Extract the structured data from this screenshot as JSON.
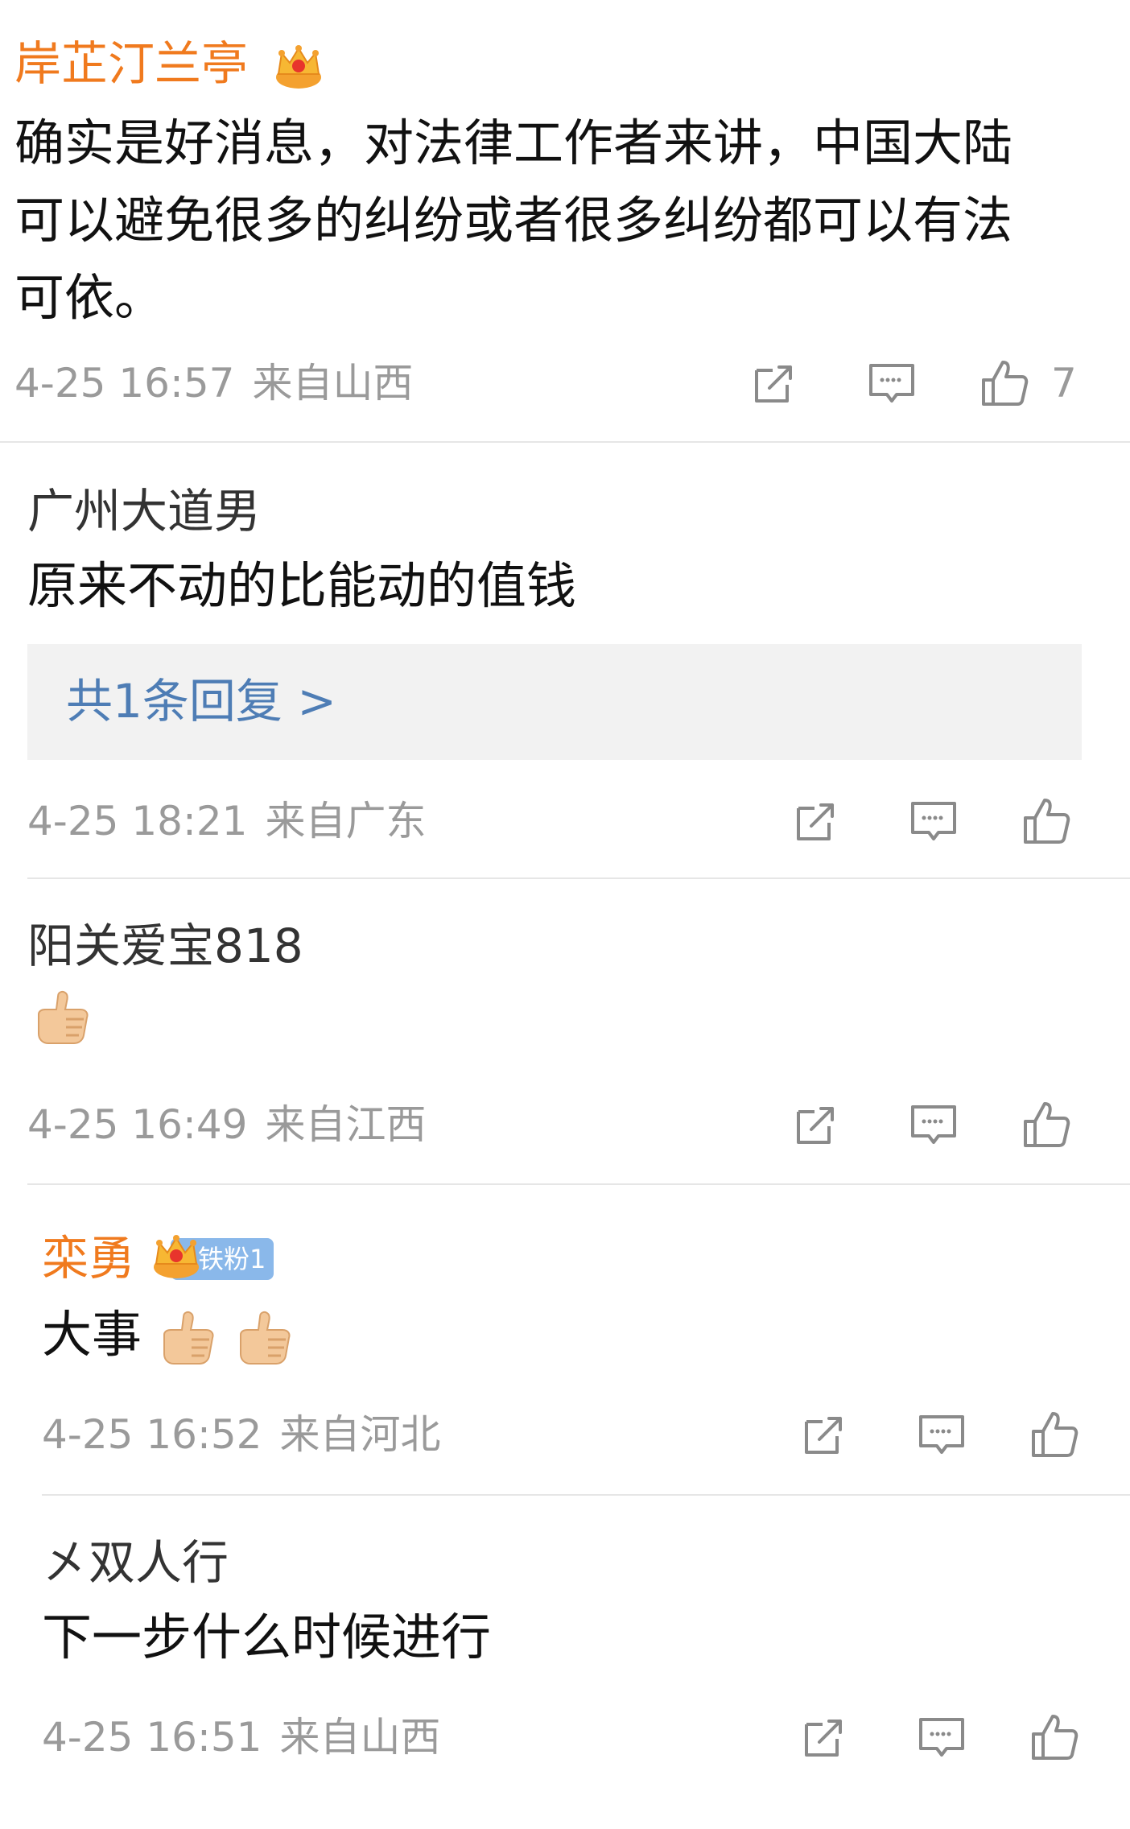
{
  "colors": {
    "vip_name": "#f07a1e",
    "normal_name": "#333333",
    "meta": "#9a9a9a",
    "link": "#4e7db5",
    "reply_bg": "#f2f2f2",
    "divider": "#e6e6e6",
    "fan_badge": "#8ab8ea"
  },
  "comments": [
    {
      "username": "岸芷汀兰亭",
      "vip": true,
      "crown_icon": "crown-icon",
      "content_lines": [
        "确实是好消息，对法律工作者来讲，中国大陆",
        "可以避免很多的纠纷或者很多纠纷都可以有法",
        "可依。"
      ],
      "date": "4-25 16:57",
      "location": "来自山西",
      "like_count": "7"
    },
    {
      "username": "广州大道男",
      "vip": false,
      "content_lines": [
        "原来不动的比能动的值钱"
      ],
      "reply_link": "共1条回复 >",
      "date": "4-25 18:21",
      "location": "来自广东",
      "like_count": ""
    },
    {
      "username": "阳关爱宝818",
      "vip": false,
      "content_emoji": "thumbs-up-emoji",
      "date": "4-25 16:49",
      "location": "来自江西",
      "like_count": ""
    },
    {
      "username": "栾勇",
      "vip": true,
      "crown_icon": "crown-icon",
      "fan_badge": "铁粉1",
      "content_text": "大事",
      "content_emoji": "thumbs-up-emoji",
      "date": "4-25 16:52",
      "location": "来自河北",
      "like_count": ""
    },
    {
      "username": "㐅双人行",
      "vip": false,
      "content_lines": [
        "下一步什么时候进行"
      ],
      "date": "4-25 16:51",
      "location": "来自山西",
      "like_count": ""
    }
  ],
  "icons": {
    "repost": "repost-icon",
    "comment": "comment-icon",
    "like": "like-icon"
  }
}
